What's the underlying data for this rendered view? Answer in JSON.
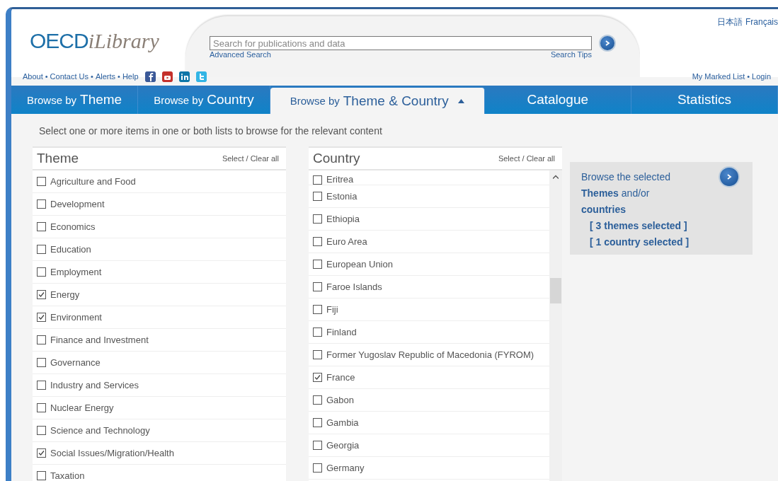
{
  "header": {
    "logo": {
      "main": "OECD",
      "script": "iLibrary"
    },
    "search": {
      "placeholder": "Search for publications and data"
    },
    "advanced_search": "Advanced Search",
    "search_tips": "Search Tips",
    "languages": [
      "日本語",
      "Français"
    ],
    "links_left": [
      "About",
      "Contact Us",
      "Alerts",
      "Help"
    ],
    "separator": "•",
    "social": [
      {
        "kind": "facebook"
      },
      {
        "kind": "youtube"
      },
      {
        "kind": "linkedin"
      },
      {
        "kind": "twitter"
      }
    ],
    "links_right": [
      "My Marked List",
      "Login"
    ]
  },
  "tabs": [
    {
      "prefix": "Browse by",
      "label": "Theme",
      "selected": false
    },
    {
      "prefix": "Browse by",
      "label": "Country",
      "selected": false
    },
    {
      "prefix": "Browse by",
      "label": "Theme & Country",
      "selected": true
    },
    {
      "label": "Catalogue",
      "selected": false
    },
    {
      "label": "Statistics",
      "selected": false
    }
  ],
  "instruction": "Select one or more items in one or both lists to browse for the relevant content",
  "lists": [
    {
      "title": "Theme",
      "action": "Select / Clear all",
      "scrolled": false,
      "items": [
        {
          "label": "Agriculture and Food",
          "checked": false
        },
        {
          "label": "Development",
          "checked": false
        },
        {
          "label": "Economics",
          "checked": false
        },
        {
          "label": "Education",
          "checked": false
        },
        {
          "label": "Employment",
          "checked": false
        },
        {
          "label": "Energy",
          "checked": true
        },
        {
          "label": "Environment",
          "checked": true
        },
        {
          "label": "Finance and Investment",
          "checked": false
        },
        {
          "label": "Governance",
          "checked": false
        },
        {
          "label": "Industry and Services",
          "checked": false
        },
        {
          "label": "Nuclear Energy",
          "checked": false
        },
        {
          "label": "Science and Technology",
          "checked": false
        },
        {
          "label": "Social Issues/Migration/Health",
          "checked": true
        },
        {
          "label": "Taxation",
          "checked": false
        }
      ]
    },
    {
      "title": "Country",
      "action": "Select / Clear all",
      "scrolled": true,
      "items": [
        {
          "label": "Eritrea",
          "checked": false
        },
        {
          "label": "Estonia",
          "checked": false
        },
        {
          "label": "Ethiopia",
          "checked": false
        },
        {
          "label": "Euro Area",
          "checked": false
        },
        {
          "label": "European Union",
          "checked": false
        },
        {
          "label": "Faroe Islands",
          "checked": false
        },
        {
          "label": "Fiji",
          "checked": false
        },
        {
          "label": "Finland",
          "checked": false
        },
        {
          "label": "Former Yugoslav Republic of Macedonia (FYROM)",
          "checked": false
        },
        {
          "label": "France",
          "checked": true
        },
        {
          "label": "Gabon",
          "checked": false
        },
        {
          "label": "Gambia",
          "checked": false
        },
        {
          "label": "Georgia",
          "checked": false
        },
        {
          "label": "Germany",
          "checked": false
        }
      ]
    }
  ],
  "browse_box": {
    "text": "Browse the selected **Themes** and/or **countries**",
    "selections": [
      "[ 3 themes selected ]",
      "[ 1 country selected ]"
    ]
  }
}
